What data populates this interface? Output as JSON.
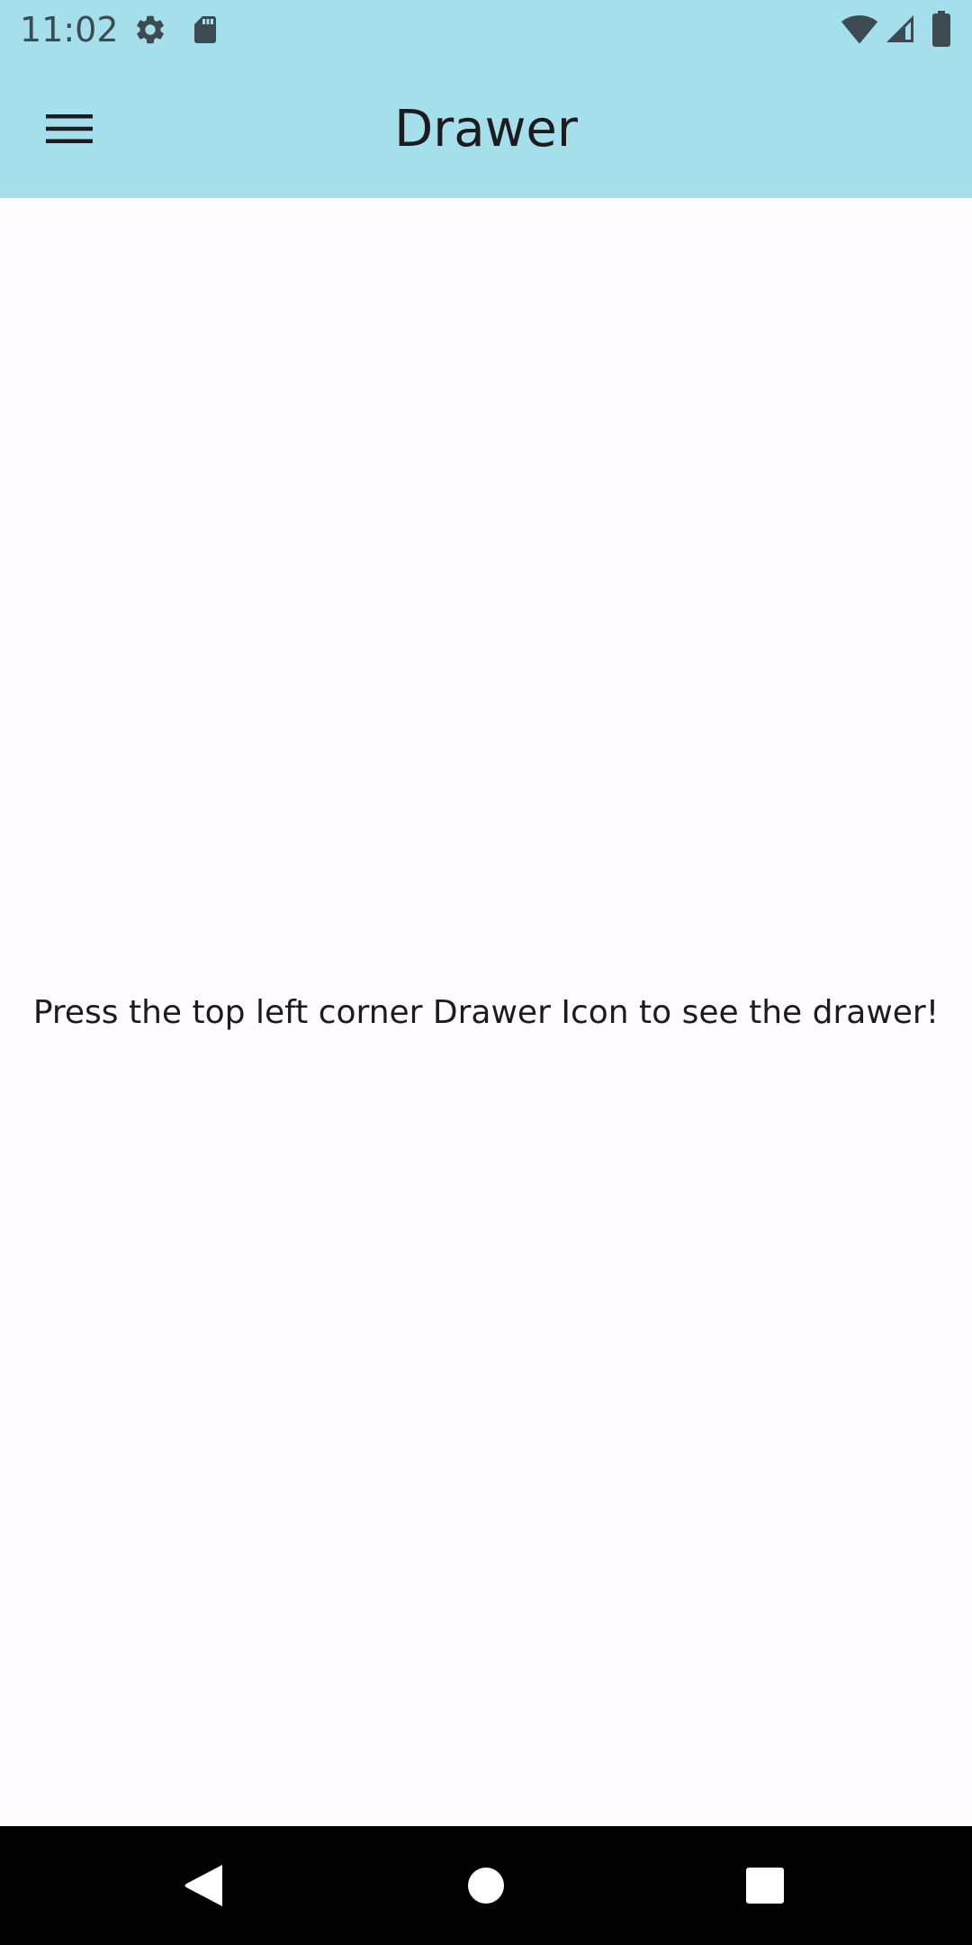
{
  "status_bar": {
    "time": "11:02",
    "icons": [
      "settings-icon",
      "sd-card-icon",
      "wifi-icon",
      "cellular-signal-icon",
      "battery-icon"
    ]
  },
  "app_bar": {
    "title": "Drawer",
    "menu_icon": "hamburger-menu-icon"
  },
  "main": {
    "message": "Press the top left corner Drawer Icon to see the drawer!"
  },
  "nav_bar": {
    "buttons": [
      "back-icon",
      "home-icon",
      "recents-icon"
    ]
  },
  "colors": {
    "app_bar_background": "#a6dfec",
    "page_background": "#fffbfe",
    "nav_bar_background": "#000000",
    "text": "#1d1b20"
  }
}
